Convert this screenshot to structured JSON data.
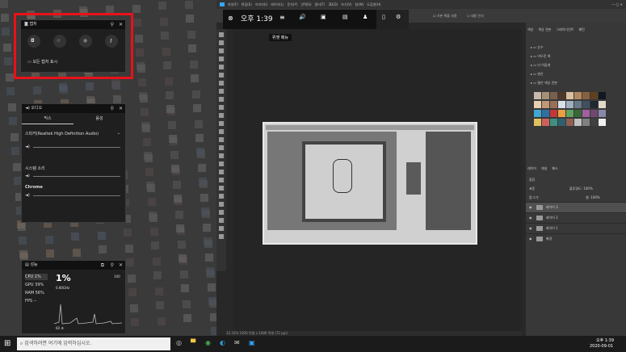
{
  "gamebar": {
    "time": "오후 1:39",
    "widget_menu": "위젯 메뉴"
  },
  "capture": {
    "title": "캡처",
    "show_all": "모든 캡처 표시"
  },
  "audio": {
    "title": "오디오",
    "tab_mix": "믹스",
    "tab_voice": "음성",
    "device": "스피커(Realtek High Definition Audio)",
    "system": "시스템 소리",
    "chrome": "Chrome"
  },
  "perf": {
    "title": "성능",
    "cpu_label": "CPU",
    "cpu_val": "1%",
    "gpu_label": "GPU",
    "gpu_val": "39%",
    "ram_label": "RAM",
    "ram_val": "56%",
    "fps_label": "FPS",
    "fps_val": "--",
    "big": "1%",
    "freq": "0.80GHz",
    "max": "100",
    "time": "60 초"
  },
  "photoshop": {
    "menu": [
      "파일(F)",
      "편집(E)",
      "이미지(I)",
      "레이어(L)",
      "문자(Y)",
      "선택(S)",
      "필터(T)",
      "3D(D)",
      "보기(V)",
      "창(W)",
      "도움말(H)"
    ],
    "opt_default": "기본 획을 사용",
    "opt_content": "내용 인식",
    "swatch_tabs": [
      "색상",
      "색상 견본",
      "그레이디언트",
      "패턴"
    ],
    "swatch_groups": [
      "순수",
      "어두운 색",
      "더 어둡게",
      "밝은",
      "옅은 색상 견본"
    ],
    "layer_tabs": [
      "레이어",
      "채널",
      "패스"
    ],
    "blend": "표준",
    "opacity": "불투명도: 100%",
    "lock": "잠그기:",
    "fill": "칠: 100%",
    "kind": "종류",
    "layers": [
      "레이어 3",
      "레이어 2",
      "레이어 1",
      "배경"
    ],
    "status": "33.33%   1920 픽셀 x 1080 픽셀 (72 ppi)"
  },
  "taskbar": {
    "search": "검색하려면 여기에 입력하십시오.",
    "time": "오후 1:39",
    "date": "2020-09-01"
  }
}
